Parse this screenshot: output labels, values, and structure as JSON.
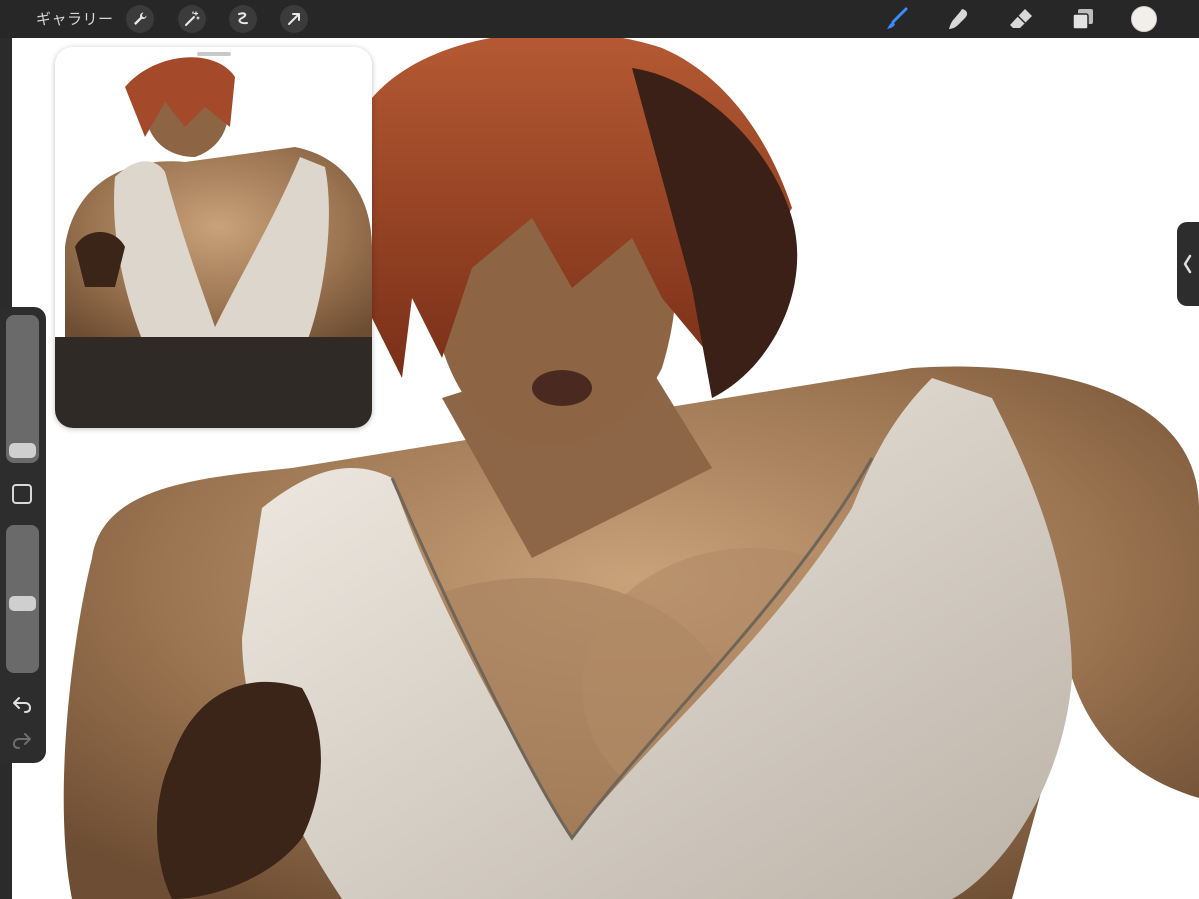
{
  "topbar": {
    "gallery_label": "ギャラリー",
    "tools_left": [
      "wrench-icon",
      "magic-wand-icon",
      "selection-icon",
      "transform-arrow-icon"
    ],
    "tools_right": [
      "brush-icon",
      "smudge-icon",
      "eraser-icon",
      "layers-icon"
    ],
    "active_tool": "brush-icon",
    "active_color": "#f2efeb",
    "accent": "#3a8bff"
  },
  "sidebar": {
    "brush_size_level": 0.05,
    "opacity_level": 0.5
  },
  "canvas": {
    "background": "#ffffff",
    "skin_color": "#8f6a47",
    "hair_color": "#a44a2a",
    "shirt_color": "#d9d2c8"
  }
}
